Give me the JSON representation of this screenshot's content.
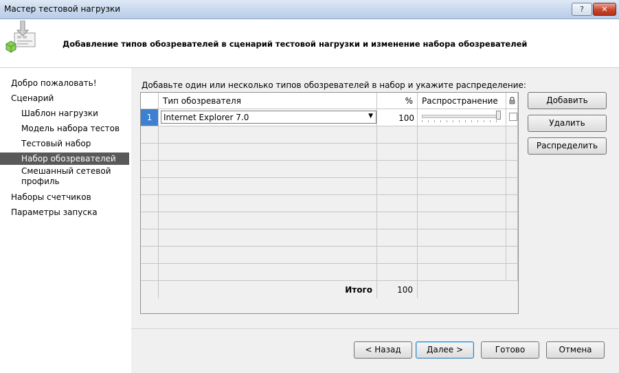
{
  "window": {
    "title": "Мастер тестовой нагрузки",
    "help_label": "?",
    "close_label": "✕"
  },
  "header": {
    "title": "Добавление типов обозревателей в сценарий тестовой нагрузки и изменение набора обозревателей",
    "icon": "wizard-icon"
  },
  "nav": {
    "welcome": "Добро пожаловать!",
    "scenario": "Сценарий",
    "load_pattern": "Шаблон нагрузки",
    "test_mix_model": "Модель набора тестов",
    "test_mix": "Тестовый набор",
    "browser_mix": "Набор обозревателей",
    "network_mix": "Смешанный сетевой профиль",
    "counter_sets": "Наборы счетчиков",
    "run_settings": "Параметры запуска"
  },
  "main": {
    "instruction": "Добавьте один или несколько типов обозревателей в набор и укажите распределение:",
    "columns": {
      "browser_type": "Тип обозревателя",
      "percent": "%",
      "distribution": "Распространение",
      "lock_icon": "lock-icon"
    },
    "rows": [
      {
        "index": "1",
        "browser": "Internet Explorer 7.0",
        "percent": "100",
        "distribution": 1.0,
        "locked": false
      }
    ],
    "total_label": "Итого",
    "total_value": "100"
  },
  "buttons": {
    "add": "Добавить",
    "remove": "Удалить",
    "distribute": "Распределить",
    "back": "< Назад",
    "next": "Далее >",
    "finish": "Готово",
    "cancel": "Отмена"
  }
}
